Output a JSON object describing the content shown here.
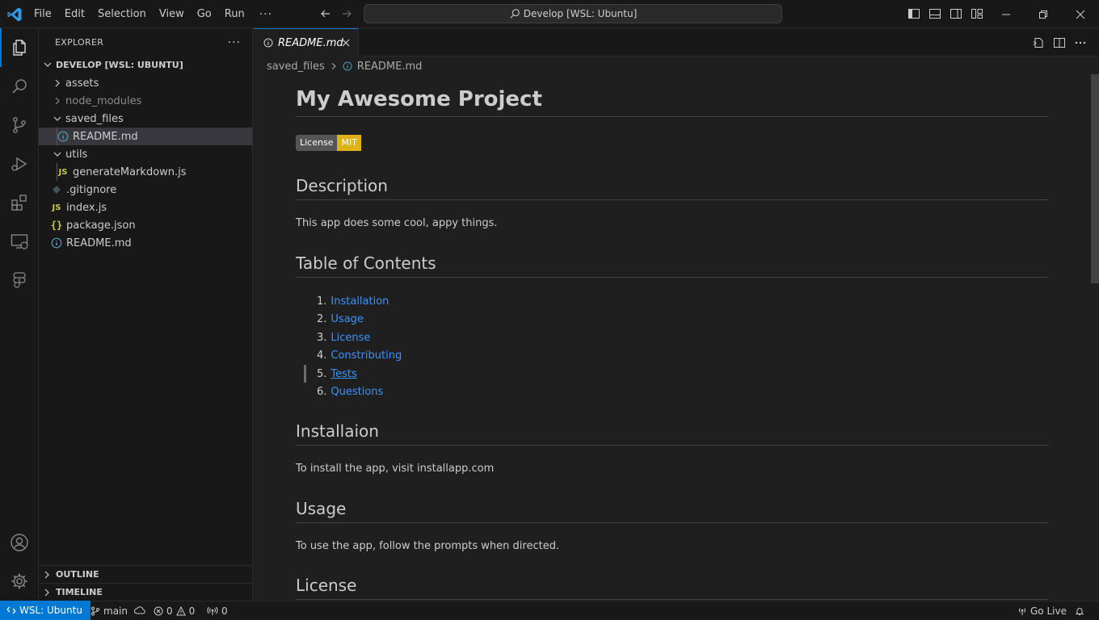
{
  "app": {
    "menu": [
      "File",
      "Edit",
      "Selection",
      "View",
      "Go",
      "Run"
    ],
    "more_menu": "···",
    "command_center": "Develop [WSL: Ubuntu]"
  },
  "sidebar": {
    "title": "EXPLORER",
    "more": "···",
    "root": "DEVELOP [WSL: UBUNTU]",
    "tree": [
      {
        "label": "assets",
        "type": "folder",
        "expanded": false,
        "depth": 0
      },
      {
        "label": "node_modules",
        "type": "folder",
        "expanded": false,
        "depth": 0
      },
      {
        "label": "saved_files",
        "type": "folder",
        "expanded": true,
        "depth": 0
      },
      {
        "label": "README.md",
        "type": "file-info",
        "depth": 1,
        "selected": true
      },
      {
        "label": "utils",
        "type": "folder",
        "expanded": true,
        "depth": 0
      },
      {
        "label": "generateMarkdown.js",
        "type": "file-js",
        "depth": 1
      },
      {
        "label": ".gitignore",
        "type": "file-git",
        "depth": 0
      },
      {
        "label": "index.js",
        "type": "file-js",
        "depth": 0
      },
      {
        "label": "package.json",
        "type": "file-json",
        "depth": 0
      },
      {
        "label": "README.md",
        "type": "file-info",
        "depth": 0
      }
    ],
    "outline": "OUTLINE",
    "timeline": "TIMELINE"
  },
  "editor": {
    "tab_label": "README.md",
    "breadcrumb": [
      "saved_files",
      "README.md"
    ]
  },
  "preview": {
    "title": "My Awesome Project",
    "badge": {
      "label": "License",
      "value": "MIT",
      "color": "#dfb317"
    },
    "description_heading": "Description",
    "description_text": "This app does some cool, appy things.",
    "toc_heading": "Table of Contents",
    "toc": [
      {
        "num": "1.",
        "label": "Installation"
      },
      {
        "num": "2.",
        "label": "Usage"
      },
      {
        "num": "3.",
        "label": "License"
      },
      {
        "num": "4.",
        "label": "Constributing"
      },
      {
        "num": "5.",
        "label": "Tests"
      },
      {
        "num": "6.",
        "label": "Questions"
      }
    ],
    "install_heading": "Installaion",
    "install_text": "To install the app, visit installapp.com",
    "usage_heading": "Usage",
    "usage_text": "To use the app, follow the prompts when directed.",
    "license_heading": "License"
  },
  "statusbar": {
    "remote": "WSL: Ubuntu",
    "branch": "main",
    "errors": "0",
    "warnings": "0",
    "ports": "0",
    "golive": "Go Live"
  },
  "colors": {
    "accent": "#0078d4",
    "link": "#3794ff"
  }
}
